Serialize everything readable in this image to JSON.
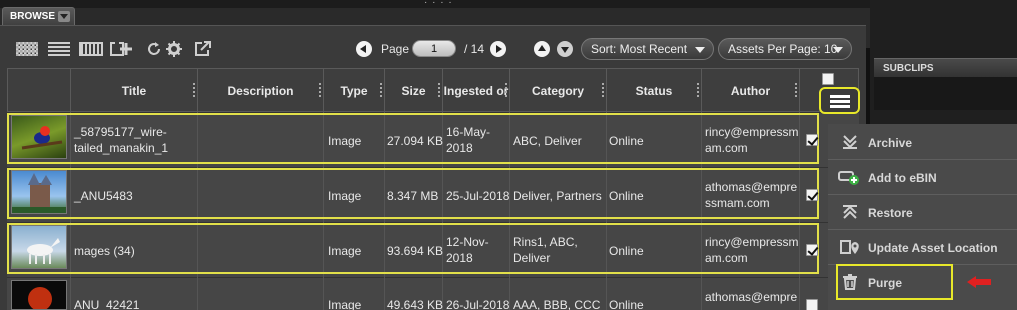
{
  "browse_tab": {
    "label": "BROWSE"
  },
  "subclips": {
    "label": "SUBCLIPS"
  },
  "pagination": {
    "page_label": "Page",
    "current_page": "1",
    "total": "/ 14"
  },
  "sort": {
    "label": "Sort: Most Recent"
  },
  "assets_per_page": {
    "label": "Assets Per Page: 10"
  },
  "columns": [
    "Title",
    "Description",
    "Type",
    "Size",
    "Ingested or",
    "Category",
    "Status",
    "Author"
  ],
  "rows": [
    {
      "title_line1": "_58795177_wire-",
      "title_line2": "tailed_manakin_1",
      "description": "",
      "type": "Image",
      "size": "27.094 KB",
      "ingested_line1": "16-May-",
      "ingested_line2": "2018",
      "category_line1": "ABC, Deliver",
      "category_line2": "",
      "status": "Online",
      "author_line1": "rincy@empressm",
      "author_line2": "am.com",
      "checked": true
    },
    {
      "title_line1": "_ANU5483",
      "title_line2": "",
      "description": "",
      "type": "Image",
      "size": "8.347 MB",
      "ingested_line1": "25-Jul-2018",
      "ingested_line2": "",
      "category_line1": "Deliver, Partners",
      "category_line2": "",
      "status": "Online",
      "author_line1": "athomas@empre",
      "author_line2": "ssmam.com",
      "checked": true
    },
    {
      "title_line1": "mages (34)",
      "title_line2": "",
      "description": "",
      "type": "Image",
      "size": "93.694 KB",
      "ingested_line1": "12-Nov-",
      "ingested_line2": "2018",
      "category_line1": "Rins1, ABC,",
      "category_line2": "Deliver",
      "status": "Online",
      "author_line1": "rincy@empressm",
      "author_line2": "am.com",
      "checked": true
    },
    {
      "title_line1": "ANU_42421",
      "title_line2": "",
      "description": "",
      "type": "Image",
      "size": "49.643 KB",
      "ingested_line1": "26-Jul-2018",
      "ingested_line2": "",
      "category_line1": "AAA, BBB, CCC",
      "category_line2": "",
      "status": "Online",
      "author_line1": "athomas@empre",
      "author_line2": "",
      "checked": false
    }
  ],
  "menu": {
    "items": [
      {
        "label": "Archive",
        "icon": "archive-icon"
      },
      {
        "label": "Add to eBIN",
        "icon": "add-to-bin-icon"
      },
      {
        "label": "Restore",
        "icon": "restore-icon"
      },
      {
        "label": "Update Asset Location",
        "icon": "location-icon"
      },
      {
        "label": "Purge",
        "icon": "trash-icon"
      }
    ]
  },
  "colors": {
    "highlight": "#e2e04a",
    "arrow": "#e02020",
    "panel": "#3a3a3a"
  }
}
